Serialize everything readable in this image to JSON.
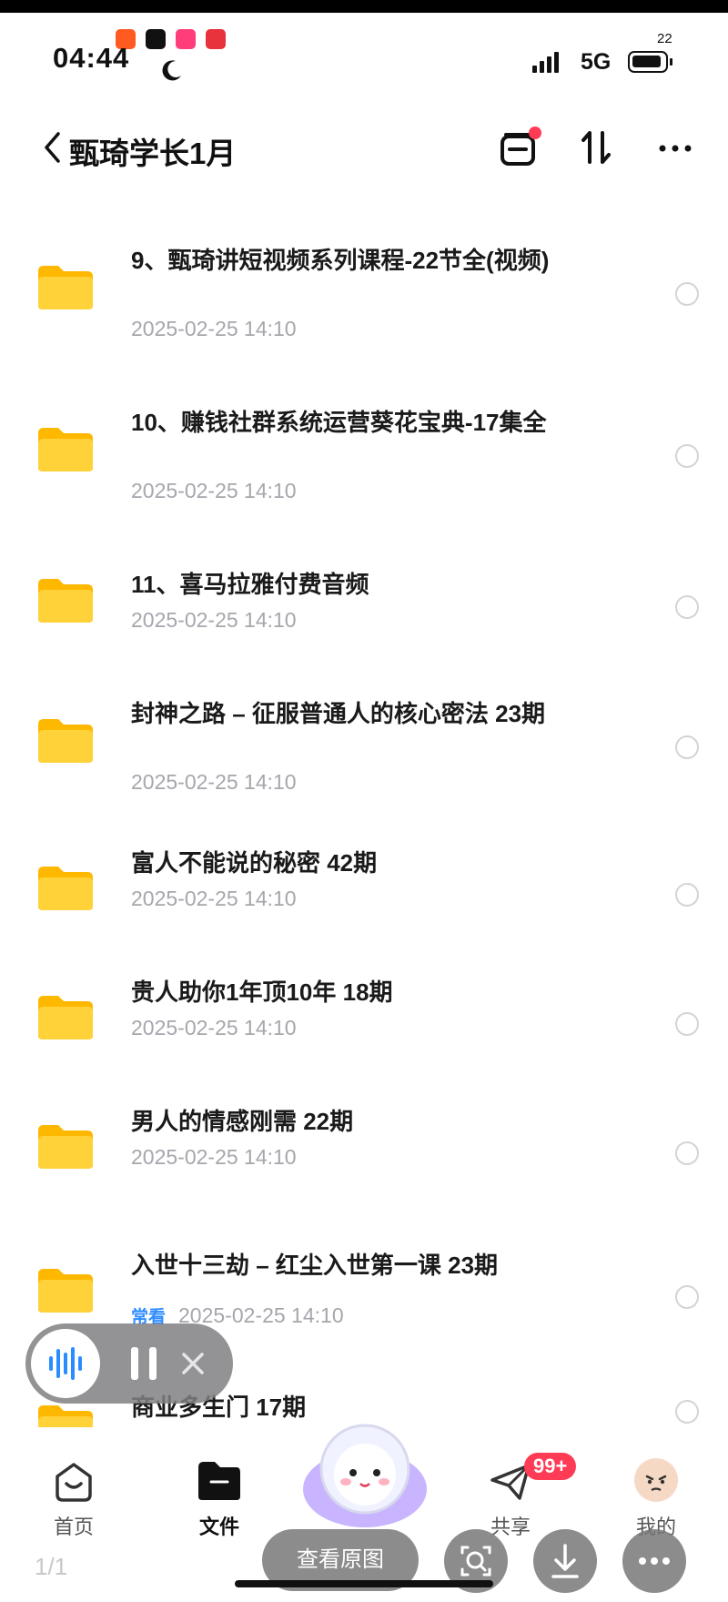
{
  "status_bar": {
    "time": "04:44",
    "network": "5G",
    "battery_level": "22",
    "notif_colors": [
      "#ff5a1f",
      "#111111",
      "#ff3d7a",
      "#e8323c"
    ]
  },
  "header": {
    "title": "甄琦学长1月"
  },
  "folders": [
    {
      "name": "9、甄琦讲短视频系列课程-22节全(视频)",
      "date": "2025-02-25 14:10"
    },
    {
      "name": "10、赚钱社群系统运营葵花宝典-17集全",
      "date": "2025-02-25 14:10"
    },
    {
      "name": "11、喜马拉雅付费音频",
      "date": "2025-02-25 14:10"
    },
    {
      "name": "封神之路 – 征服普通人的核心密法 23期",
      "date": "2025-02-25 14:10"
    },
    {
      "name": "富人不能说的秘密 42期",
      "date": "2025-02-25 14:10"
    },
    {
      "name": "贵人助你1年顶10年 18期",
      "date": "2025-02-25 14:10"
    },
    {
      "name": "男人的情感刚需 22期",
      "date": "2025-02-25 14:10"
    },
    {
      "name": "入世十三劫 – 红尘入世第一课 23期",
      "date": "2025-02-25 14:10",
      "tag": "常看"
    },
    {
      "name": "商业多生门 17期",
      "date": ""
    }
  ],
  "nav": {
    "home": "首页",
    "files": "文件",
    "share": "共享",
    "mine": "我的",
    "share_badge": "99+"
  },
  "viewer": {
    "counter": "1/1",
    "view_original": "查看原图"
  },
  "colors": {
    "folder": "#ffc92e",
    "accent_red": "#ff3b55",
    "date_gray": "#a6a6ad"
  }
}
